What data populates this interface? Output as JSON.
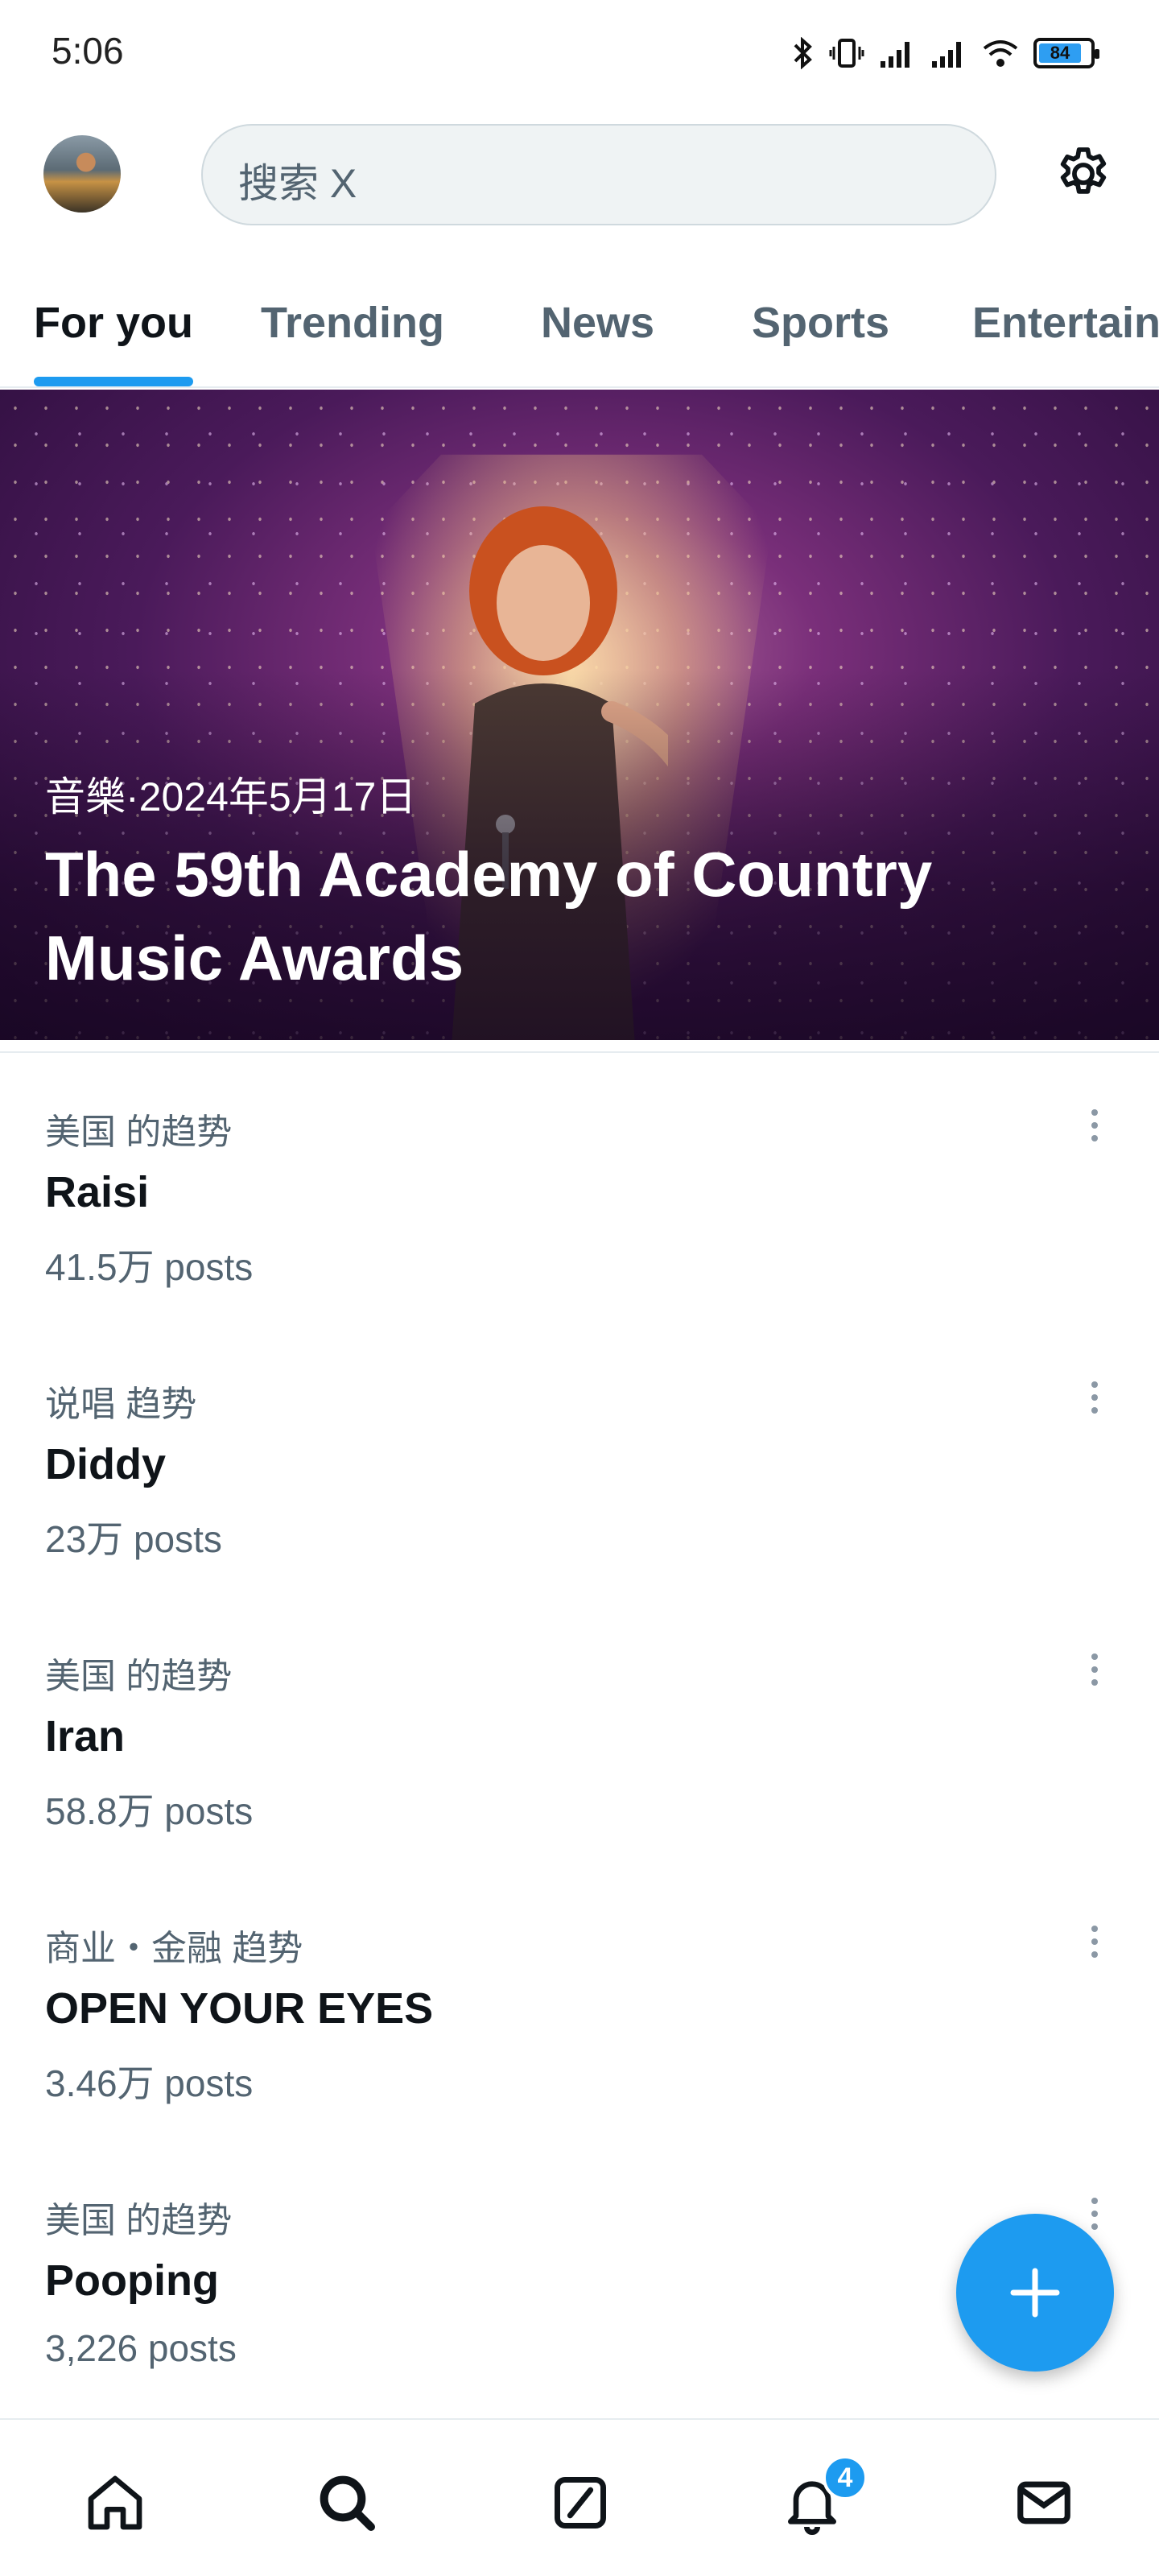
{
  "status_bar": {
    "time": "5:06",
    "battery_level": "84",
    "icons": [
      "bluetooth-icon",
      "vibrate-icon",
      "signal-icon",
      "signal-icon",
      "wifi-icon",
      "battery-icon"
    ]
  },
  "header": {
    "search_placeholder": "搜索 X",
    "avatar_icon": "avatar",
    "settings_icon": "gear-icon"
  },
  "tabs": [
    {
      "label": "For you",
      "active": true
    },
    {
      "label": "Trending",
      "active": false
    },
    {
      "label": "News",
      "active": false
    },
    {
      "label": "Sports",
      "active": false
    },
    {
      "label": "Entertain",
      "active": false
    }
  ],
  "hero": {
    "meta": "音樂·2024年5月17日",
    "title": "The 59th Academy of Country Music Awards"
  },
  "trends": [
    {
      "context": "美国 的趋势",
      "name": "Raisi",
      "count": "41.5万 posts"
    },
    {
      "context": "说唱 趋势",
      "name": "Diddy",
      "count": "23万 posts"
    },
    {
      "context": "美国 的趋势",
      "name": "Iran",
      "count": "58.8万 posts"
    },
    {
      "context": "商业・金融 趋势",
      "name": "OPEN YOUR EYES",
      "count": "3.46万 posts"
    },
    {
      "context": "美国 的趋势",
      "name": "Pooping",
      "count": "3,226 posts"
    }
  ],
  "fab": {
    "icon": "plus-icon"
  },
  "bottom_nav": {
    "items": [
      "home-icon",
      "search-icon",
      "grok-icon",
      "bell-icon",
      "mail-icon"
    ],
    "notification_badge": "4"
  },
  "colors": {
    "accent": "#1d9bf0",
    "text_primary": "#0f1419",
    "text_secondary": "#536471"
  }
}
